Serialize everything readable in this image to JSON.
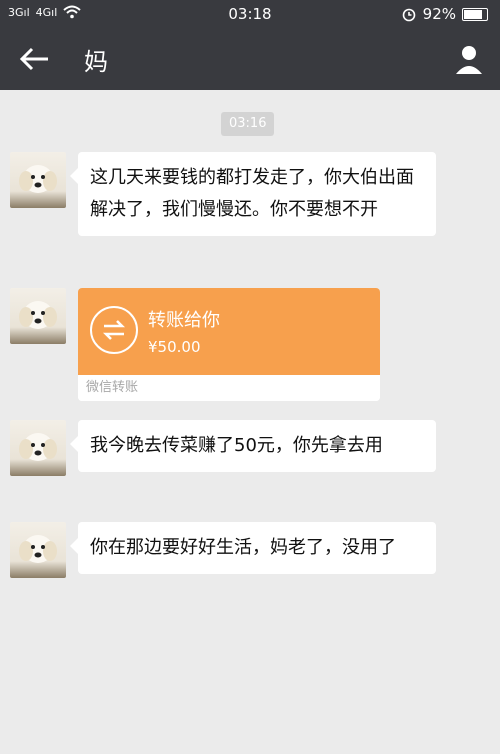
{
  "status_bar": {
    "signal_1": "3Gıl",
    "signal_2": "4Gıl",
    "time": "03:18",
    "battery": "92%"
  },
  "header": {
    "title": "妈"
  },
  "chat": {
    "timestamp": "03:16",
    "messages": [
      {
        "type": "text",
        "text": "这几天来要钱的都打发走了，你大伯出面解决了，我们慢慢还。你不要想不开"
      },
      {
        "type": "transfer",
        "title": "转账给你",
        "amount": "¥50.00",
        "footer": "微信转账"
      },
      {
        "type": "text",
        "text": "我今晚去传菜赚了50元，你先拿去用"
      },
      {
        "type": "text",
        "text": "你在那边要好好生活，妈老了，没用了"
      }
    ]
  },
  "colors": {
    "bar": "#393a3f",
    "transfer": "#f7a04d",
    "chat_bg": "#ebebeb"
  }
}
